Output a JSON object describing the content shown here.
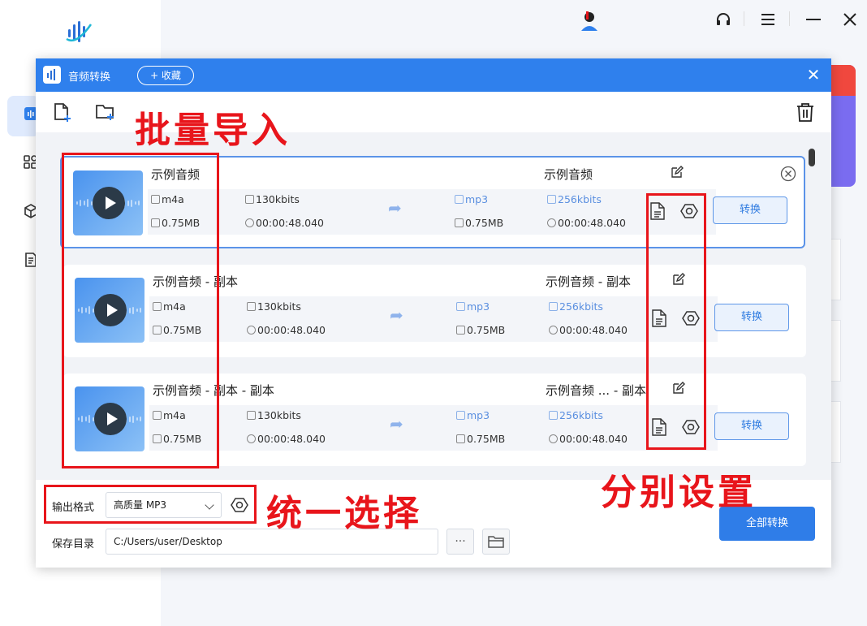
{
  "background": {
    "nav_icons": [
      "audio-wave-icon",
      "grid-icon",
      "cube-icon",
      "document-icon"
    ],
    "topbar_icons": [
      "headset-icon",
      "menu-icon",
      "minimize-icon",
      "close-icon"
    ]
  },
  "dialog": {
    "title": "音频转换",
    "favorite_label": "+ 收藏",
    "close_glyph": "✕"
  },
  "files": [
    {
      "name": "示例音频",
      "format": "m4a",
      "bitrate": "130kbits",
      "size": "0.75MB",
      "duration": "00:00:48.040",
      "out_name": "示例音频",
      "out_format": "mp3",
      "out_bitrate": "256kbits",
      "out_size": "0.75MB",
      "out_duration": "00:00:48.040",
      "convert_label": "转换",
      "selected": true
    },
    {
      "name": "示例音频 - 副本",
      "format": "m4a",
      "bitrate": "130kbits",
      "size": "0.75MB",
      "duration": "00:00:48.040",
      "out_name": "示例音频 - 副本",
      "out_format": "mp3",
      "out_bitrate": "256kbits",
      "out_size": "0.75MB",
      "out_duration": "00:00:48.040",
      "convert_label": "转换",
      "selected": false
    },
    {
      "name": "示例音频 - 副本 - 副本",
      "format": "m4a",
      "bitrate": "130kbits",
      "size": "0.75MB",
      "duration": "00:00:48.040",
      "out_name": "示例音频 ... - 副本",
      "out_format": "mp3",
      "out_bitrate": "256kbits",
      "out_size": "0.75MB",
      "out_duration": "00:00:48.040",
      "convert_label": "转换",
      "selected": false
    }
  ],
  "bottom": {
    "format_label": "输出格式",
    "format_value": "高质量 MP3",
    "save_label": "保存目录",
    "save_path": "C:/Users/user/Desktop",
    "more_label": "···",
    "convert_all_label": "全部转换"
  },
  "annotations": {
    "batch_import": "批量导入",
    "unified_select": "统一选择",
    "individual_settings": "分别设置"
  },
  "colors": {
    "accent": "#2f80ed",
    "annotation_red": "#e8151b",
    "output_text_blue": "#5a8fe0"
  }
}
